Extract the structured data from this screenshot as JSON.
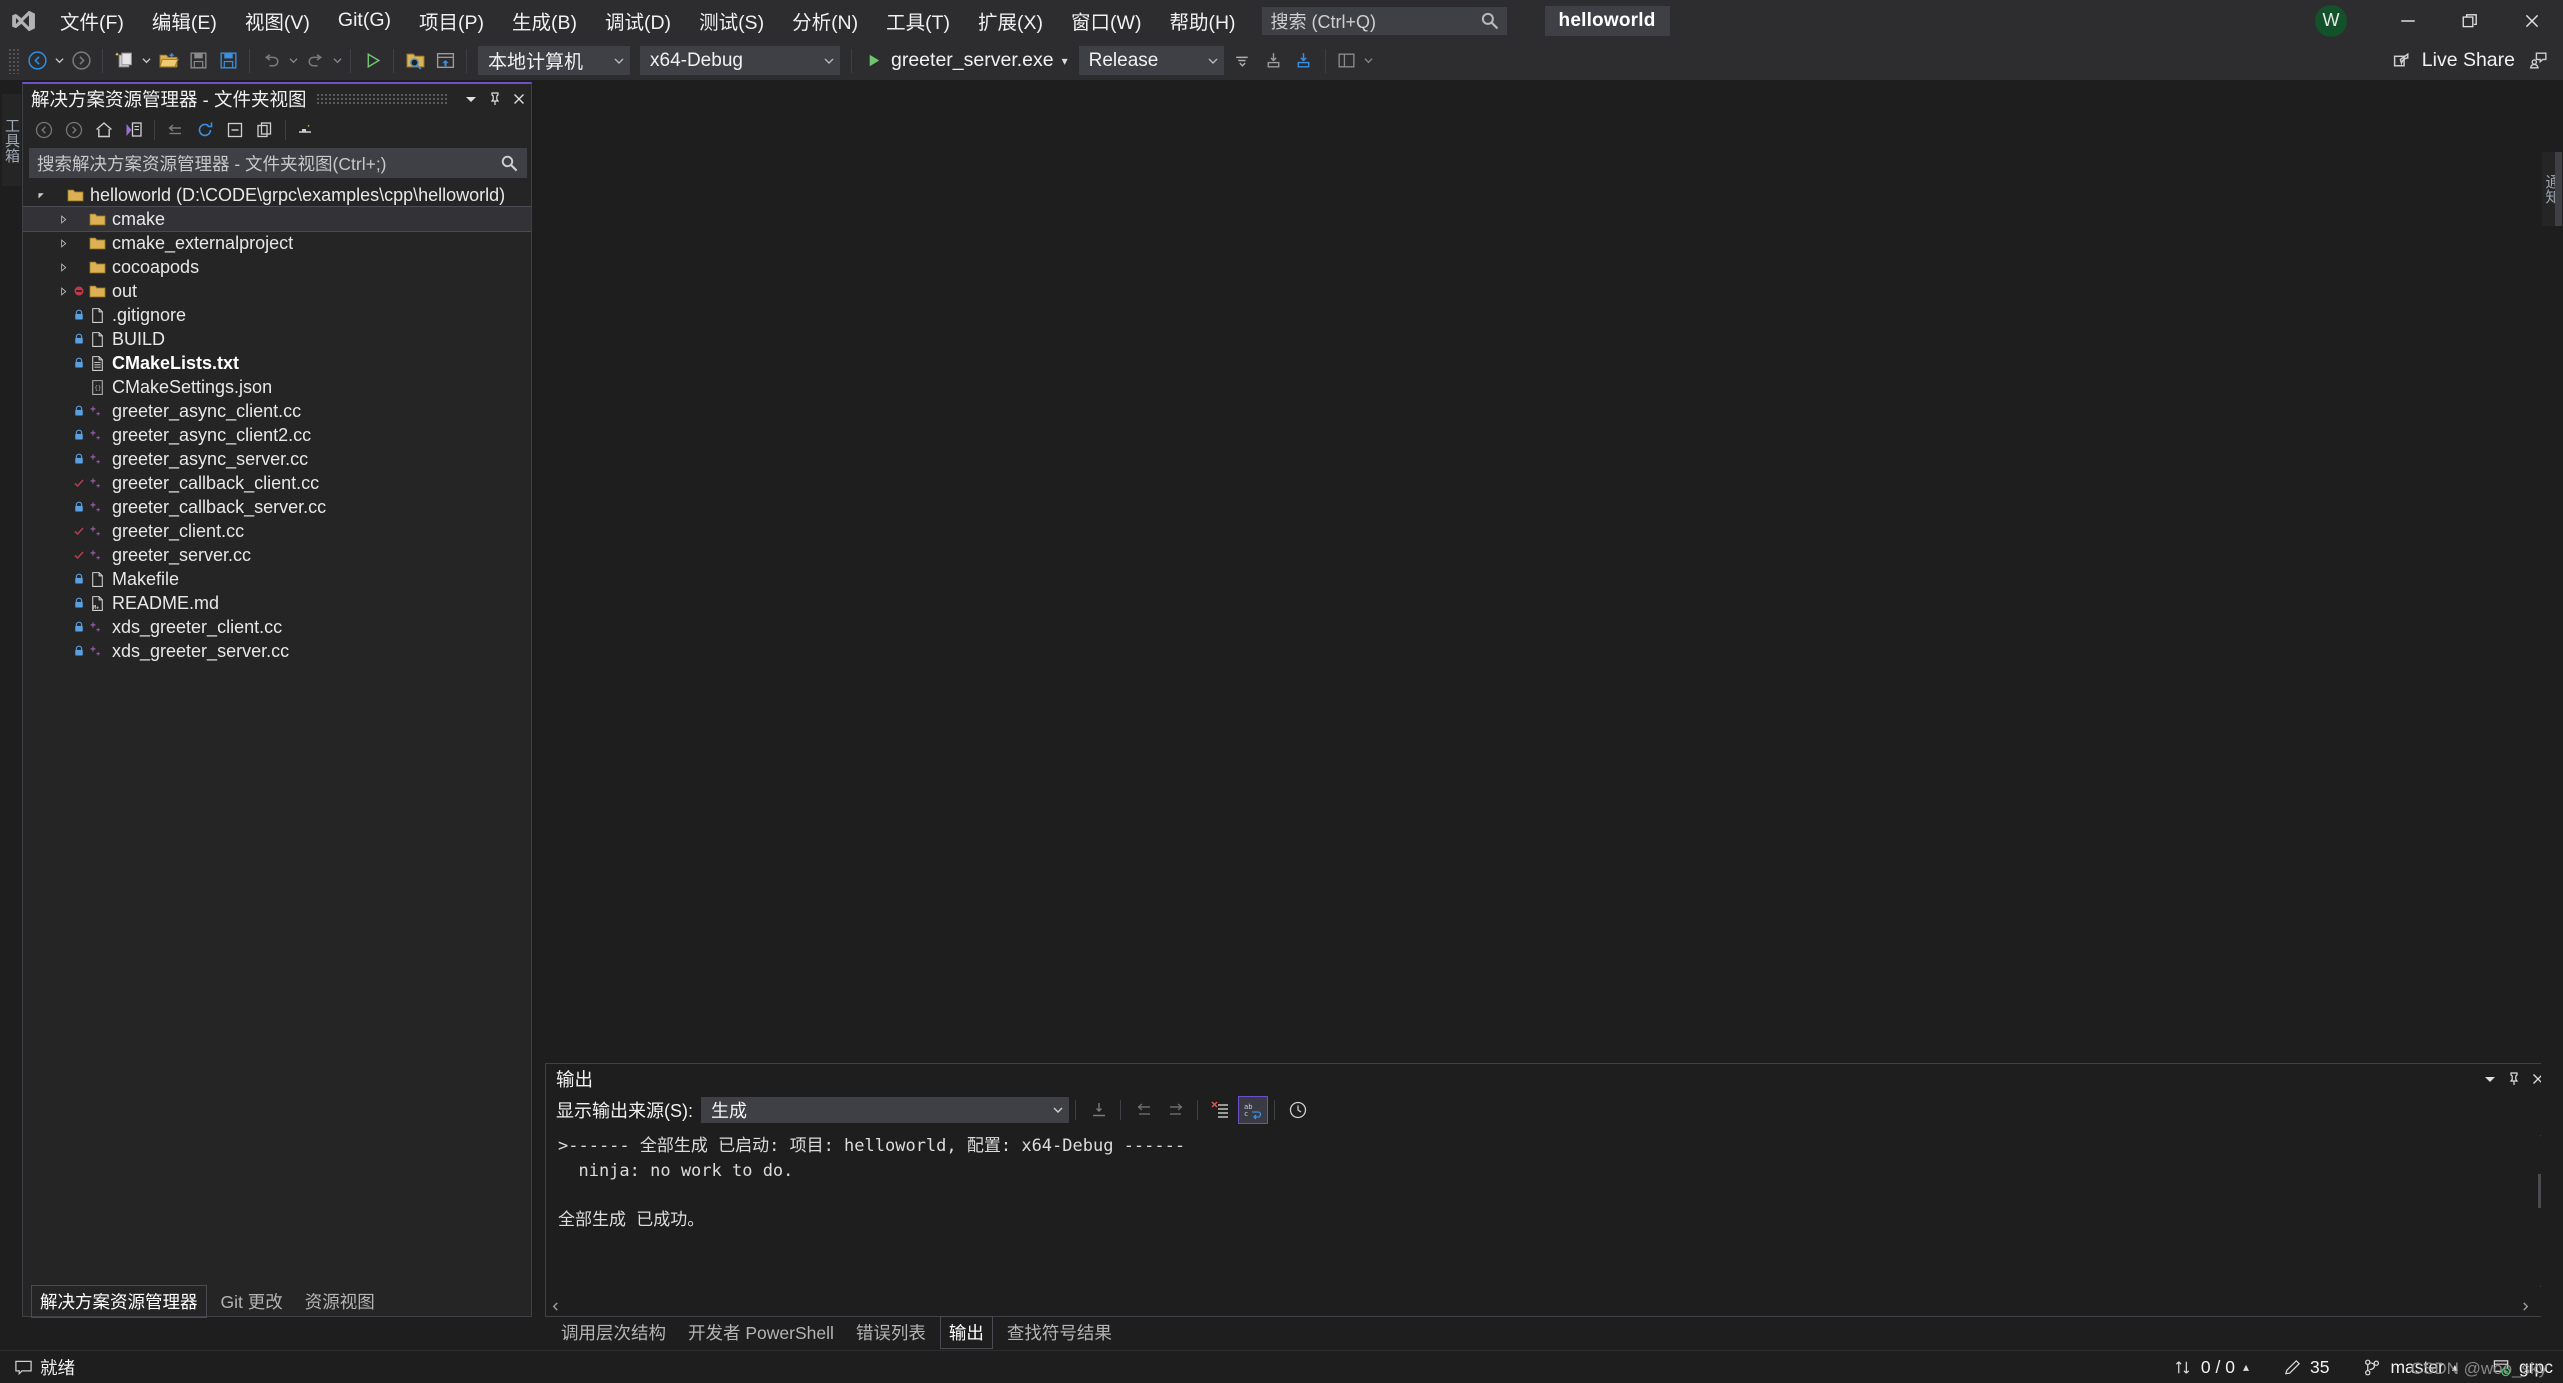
{
  "app": {
    "project_chip": "helloworld",
    "avatar_initial": "W"
  },
  "menu": {
    "items": [
      {
        "label": "文件(F)",
        "name": "menu-file"
      },
      {
        "label": "编辑(E)",
        "name": "menu-edit"
      },
      {
        "label": "视图(V)",
        "name": "menu-view"
      },
      {
        "label": "Git(G)",
        "name": "menu-git"
      },
      {
        "label": "项目(P)",
        "name": "menu-project"
      },
      {
        "label": "生成(B)",
        "name": "menu-build"
      },
      {
        "label": "调试(D)",
        "name": "menu-debug"
      },
      {
        "label": "测试(S)",
        "name": "menu-test"
      },
      {
        "label": "分析(N)",
        "name": "menu-analyze"
      },
      {
        "label": "工具(T)",
        "name": "menu-tools"
      },
      {
        "label": "扩展(X)",
        "name": "menu-extensions"
      },
      {
        "label": "窗口(W)",
        "name": "menu-window"
      },
      {
        "label": "帮助(H)",
        "name": "menu-help"
      }
    ],
    "search_placeholder": "搜索 (Ctrl+Q)"
  },
  "window_controls": {
    "minimize": "最小化",
    "restore": "还原",
    "close": "关闭"
  },
  "toolbar": {
    "target_combo": "本地计算机",
    "config_combo": "x64-Debug",
    "startup_item": "greeter_server.exe",
    "build_config_combo": "Release",
    "live_share": "Live Share"
  },
  "left_rail": {
    "tab_label": "工具箱"
  },
  "right_rail": {
    "tab_label": "通知"
  },
  "solution_explorer": {
    "title": "解决方案资源管理器 - 文件夹视图",
    "search_placeholder": "搜索解决方案资源管理器 - 文件夹视图(Ctrl+;)",
    "toolbar_icons": [
      "back-icon",
      "forward-icon",
      "home-icon",
      "sync-with-active-document-icon",
      "collapse-icon",
      "refresh-icon",
      "collapse-all-icon",
      "show-all-files-icon",
      "properties-icon"
    ],
    "tree": [
      {
        "label": "helloworld (D:\\CODE\\grpc\\examples\\cpp\\helloworld)",
        "indent": 0,
        "icon": "folder-icon",
        "expander": "expanded",
        "badge": "",
        "selected": false,
        "bold": false
      },
      {
        "label": "cmake",
        "indent": 1,
        "icon": "folder-icon",
        "expander": "collapsed",
        "badge": "",
        "selected": true,
        "bold": false
      },
      {
        "label": "cmake_externalproject",
        "indent": 1,
        "icon": "folder-icon",
        "expander": "collapsed",
        "badge": "",
        "selected": false,
        "bold": false
      },
      {
        "label": "cocoapods",
        "indent": 1,
        "icon": "folder-icon",
        "expander": "collapsed",
        "badge": "",
        "selected": false,
        "bold": false
      },
      {
        "label": "out",
        "indent": 1,
        "icon": "folder-icon",
        "expander": "collapsed",
        "badge": "excluded-icon",
        "selected": false,
        "bold": false
      },
      {
        "label": ".gitignore",
        "indent": 1,
        "icon": "file-icon",
        "expander": "",
        "badge": "lock-icon",
        "selected": false,
        "bold": false
      },
      {
        "label": "BUILD",
        "indent": 1,
        "icon": "file-icon",
        "expander": "",
        "badge": "lock-icon",
        "selected": false,
        "bold": false
      },
      {
        "label": "CMakeLists.txt",
        "indent": 1,
        "icon": "text-file-icon",
        "expander": "",
        "badge": "lock-icon",
        "selected": false,
        "bold": true
      },
      {
        "label": "CMakeSettings.json",
        "indent": 1,
        "icon": "json-file-icon",
        "expander": "",
        "badge": "",
        "selected": false,
        "bold": false
      },
      {
        "label": "greeter_async_client.cc",
        "indent": 1,
        "icon": "cpp-file-icon",
        "expander": "",
        "badge": "lock-icon",
        "selected": false,
        "bold": false
      },
      {
        "label": "greeter_async_client2.cc",
        "indent": 1,
        "icon": "cpp-file-icon",
        "expander": "",
        "badge": "lock-icon",
        "selected": false,
        "bold": false
      },
      {
        "label": "greeter_async_server.cc",
        "indent": 1,
        "icon": "cpp-file-icon",
        "expander": "",
        "badge": "lock-icon",
        "selected": false,
        "bold": false
      },
      {
        "label": "greeter_callback_client.cc",
        "indent": 1,
        "icon": "cpp-file-icon",
        "expander": "",
        "badge": "check-icon",
        "selected": false,
        "bold": false
      },
      {
        "label": "greeter_callback_server.cc",
        "indent": 1,
        "icon": "cpp-file-icon",
        "expander": "",
        "badge": "lock-icon",
        "selected": false,
        "bold": false
      },
      {
        "label": "greeter_client.cc",
        "indent": 1,
        "icon": "cpp-file-icon",
        "expander": "",
        "badge": "check-icon",
        "selected": false,
        "bold": false
      },
      {
        "label": "greeter_server.cc",
        "indent": 1,
        "icon": "cpp-file-icon",
        "expander": "",
        "badge": "check-icon",
        "selected": false,
        "bold": false
      },
      {
        "label": "Makefile",
        "indent": 1,
        "icon": "file-icon",
        "expander": "",
        "badge": "lock-icon",
        "selected": false,
        "bold": false
      },
      {
        "label": "README.md",
        "indent": 1,
        "icon": "markdown-file-icon",
        "expander": "",
        "badge": "lock-icon",
        "selected": false,
        "bold": false
      },
      {
        "label": "xds_greeter_client.cc",
        "indent": 1,
        "icon": "cpp-file-icon",
        "expander": "",
        "badge": "lock-icon",
        "selected": false,
        "bold": false
      },
      {
        "label": "xds_greeter_server.cc",
        "indent": 1,
        "icon": "cpp-file-icon",
        "expander": "",
        "badge": "lock-icon",
        "selected": false,
        "bold": false
      }
    ],
    "bottom_tabs": [
      {
        "label": "解决方案资源管理器",
        "active": true
      },
      {
        "label": "Git 更改",
        "active": false
      },
      {
        "label": "资源视图",
        "active": false
      }
    ]
  },
  "output_panel": {
    "title": "输出",
    "source_label": "显示输出来源(S):",
    "source_value": "生成",
    "lines": [
      ">------ 全部生成 已启动: 项目: helloworld, 配置: x64-Debug ------",
      "  ninja: no work to do.",
      "",
      "全部生成 已成功。"
    ],
    "bottom_tabs": [
      {
        "label": "调用层次结构",
        "active": false
      },
      {
        "label": "开发者 PowerShell",
        "active": false
      },
      {
        "label": "错误列表",
        "active": false
      },
      {
        "label": "输出",
        "active": true
      },
      {
        "label": "查找符号结果",
        "active": false
      }
    ]
  },
  "status_bar": {
    "ready": "就绪",
    "sync_counts": "0 / 0",
    "pending_changes": "35",
    "branch": "master",
    "repo": "grpc",
    "watermark": "CSDN @woo_sky"
  }
}
